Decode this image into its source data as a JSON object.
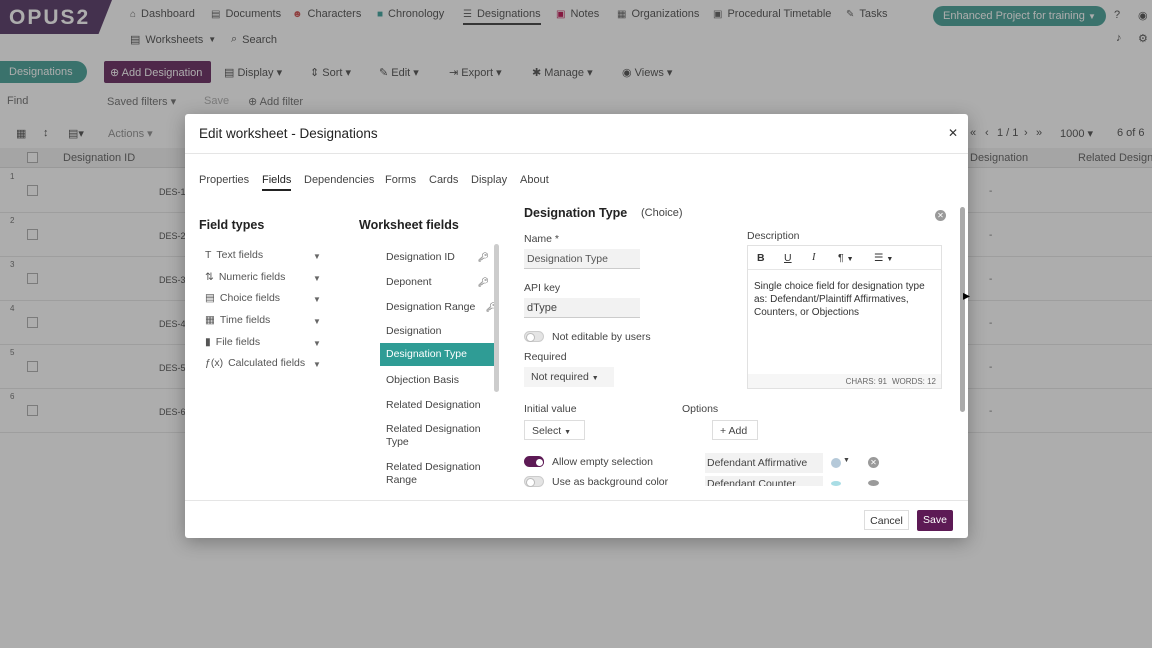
{
  "app": {
    "logo": "OPUS2",
    "project": "Enhanced Project for training"
  },
  "nav": [
    {
      "label": "Dashboard",
      "icon": "⌂"
    },
    {
      "label": "Documents",
      "icon": "▤"
    },
    {
      "label": "Characters",
      "icon": "☻"
    },
    {
      "label": "Chronology",
      "icon": "■"
    },
    {
      "label": "Designations",
      "icon": "☰"
    },
    {
      "label": "Notes",
      "icon": "▣"
    },
    {
      "label": "Organizations",
      "icon": "▦"
    },
    {
      "label": "Procedural Timetable",
      "icon": "▣"
    },
    {
      "label": "Tasks",
      "icon": "✎"
    }
  ],
  "nav2": {
    "worksheets": "Worksheets",
    "search": "Search"
  },
  "toolbar": {
    "pill": "Designations",
    "add": "Add Designation",
    "display": "Display",
    "sort": "Sort",
    "edit": "Edit",
    "export": "Export",
    "manage": "Manage",
    "views": "Views"
  },
  "filter": {
    "find": "Find",
    "saved": "Saved filters",
    "save": "Save",
    "add": "Add filter"
  },
  "grid": {
    "actions": "Actions",
    "pager": "1 / 1",
    "perpage": "1000",
    "count": "6 of 6",
    "col_id": "Designation ID",
    "col_des": "Designation",
    "col_rel": "Related Designa",
    "rows": [
      {
        "n": "1",
        "id": "DES-1"
      },
      {
        "n": "2",
        "id": "DES-2"
      },
      {
        "n": "3",
        "id": "DES-3"
      },
      {
        "n": "4",
        "id": "DES-4"
      },
      {
        "n": "5",
        "id": "DES-5"
      },
      {
        "n": "6",
        "id": "DES-6"
      }
    ],
    "dash": "-"
  },
  "modal": {
    "title": "Edit worksheet - Designations",
    "tabs": [
      "Properties",
      "Fields",
      "Dependencies",
      "Forms",
      "Cards",
      "Display",
      "About"
    ],
    "field_types_title": "Field types",
    "field_types": [
      {
        "label": "Text fields",
        "icon": "T"
      },
      {
        "label": "Numeric fields",
        "icon": "⇅"
      },
      {
        "label": "Choice fields",
        "icon": "▤"
      },
      {
        "label": "Time fields",
        "icon": "▦"
      },
      {
        "label": "File fields",
        "icon": "▮"
      },
      {
        "label": "Calculated fields",
        "icon": "ƒ(x)"
      }
    ],
    "ws_title": "Worksheet fields",
    "ws_fields": [
      {
        "label": "Designation ID",
        "key": true
      },
      {
        "label": "Deponent",
        "key": true
      },
      {
        "label": "Designation Range",
        "key": true
      },
      {
        "label": "Designation",
        "key": false
      },
      {
        "label": "Designation Type",
        "key": false
      },
      {
        "label": "Objection Basis",
        "key": false
      },
      {
        "label": "Related Designation",
        "key": false
      },
      {
        "label": "Related Designation Type",
        "key": false
      },
      {
        "label": "Related Designation Range",
        "key": false
      }
    ],
    "detail": {
      "title": "Designation Type",
      "kind": "(Choice)",
      "name_label": "Name *",
      "name_value": "Designation Type",
      "api_label": "API key",
      "api_value": "dType",
      "not_editable": "Not editable by users",
      "required_label": "Required",
      "required_value": "Not required",
      "initial_label": "Initial value",
      "initial_value": "Select",
      "options_label": "Options",
      "add_label": "Add",
      "allow_empty": "Allow empty selection",
      "bg_color": "Use as background color",
      "desc_label": "Description",
      "desc_text": "Single choice field for designation type as: Defendant/Plaintiff Affirmatives, Counters, or Objections",
      "chars": "CHARS: 91",
      "words": "WORDS: 12",
      "options": [
        {
          "label": "Defendant Affirmative",
          "color": "#b5c9d9"
        },
        {
          "label": "Defendant Counter",
          "color": "#a9dde5"
        }
      ]
    },
    "cancel": "Cancel",
    "save": "Save"
  }
}
